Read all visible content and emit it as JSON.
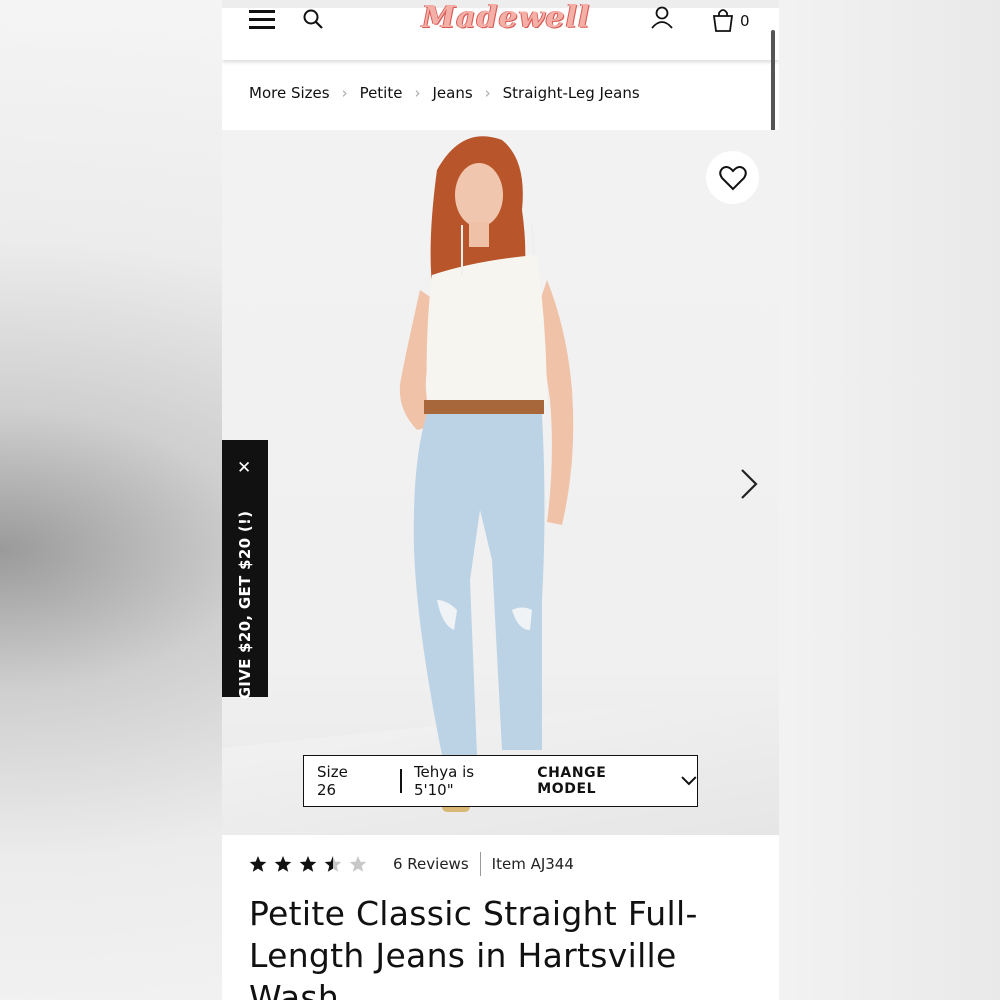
{
  "header": {
    "logo_text": "Madewell",
    "bag_count": "0"
  },
  "breadcrumb": [
    "More Sizes",
    "Petite",
    "Jeans",
    "Straight-Leg Jeans"
  ],
  "promo": {
    "text": "GIVE $20, GET $20 (!)",
    "close": "✕"
  },
  "size_bar": {
    "size": "Size 26",
    "model": "Tehya is 5'10\"",
    "change_label": "CHANGE MODEL"
  },
  "product": {
    "rating": 3.5,
    "rating_max": 5,
    "reviews": "6 Reviews",
    "item": "Item AJ344",
    "title": "Petite Classic Straight Full-Length Jeans in Hartsville Wash"
  },
  "colors": {
    "logo": "#f4b0a6",
    "logo_outline": "#d85a55",
    "promo_bg": "#111111"
  },
  "icons": [
    "hamburger-icon",
    "search-icon",
    "account-icon",
    "bag-icon",
    "heart-icon",
    "chevron-right-icon",
    "chevron-down-icon",
    "star-icon"
  ]
}
